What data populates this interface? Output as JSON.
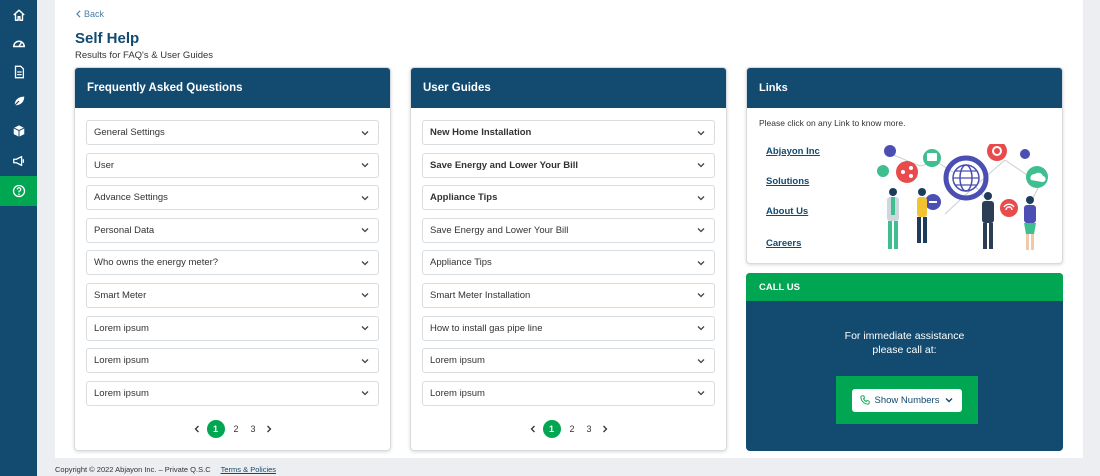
{
  "sidebar": {
    "items": [
      {
        "icon": "home-icon",
        "active": false
      },
      {
        "icon": "meter-icon",
        "active": false
      },
      {
        "icon": "document-icon",
        "active": false
      },
      {
        "icon": "leaf-icon",
        "active": false
      },
      {
        "icon": "box-icon",
        "active": false
      },
      {
        "icon": "megaphone-icon",
        "active": false
      },
      {
        "icon": "help-icon",
        "active": true
      }
    ]
  },
  "header": {
    "back_label": "Back",
    "title": "Self Help",
    "subtitle": "Results for FAQ's & User Guides"
  },
  "faq": {
    "title": "Frequently Asked Questions",
    "items": [
      "General Settings",
      "User",
      "Advance Settings",
      "Personal Data",
      "Who owns the energy meter?",
      "Smart Meter",
      "Lorem ipsum",
      "Lorem ipsum",
      "Lorem ipsum"
    ],
    "pages": [
      "1",
      "2",
      "3"
    ],
    "current_page": "1"
  },
  "guides": {
    "title": "User Guides",
    "items": [
      {
        "label": "New Home Installation",
        "bold": true
      },
      {
        "label": "Save Energy and Lower Your Bill",
        "bold": true
      },
      {
        "label": "Appliance Tips",
        "bold": true
      },
      {
        "label": "Save Energy and Lower Your Bill",
        "bold": false
      },
      {
        "label": "Appliance Tips",
        "bold": false
      },
      {
        "label": "Smart Meter Installation",
        "bold": false
      },
      {
        "label": "How to install gas pipe line",
        "bold": false
      },
      {
        "label": "Lorem ipsum",
        "bold": false
      },
      {
        "label": "Lorem ipsum",
        "bold": false
      }
    ],
    "pages": [
      "1",
      "2",
      "3"
    ],
    "current_page": "1"
  },
  "links": {
    "title": "Links",
    "intro": "Please click on any Link to know more.",
    "items": [
      "Abjayon Inc",
      "Solutions",
      "About Us",
      "Careers"
    ]
  },
  "call": {
    "title": "CALL US",
    "line1": "For immediate assistance",
    "line2": "please call at:",
    "button_label": "Show Numbers"
  },
  "footer": {
    "copyright": "Copyright © 2022 Abjayon Inc. – Private Q.S.C",
    "terms": "Terms & Policies"
  },
  "colors": {
    "navy": "#124a70",
    "green": "#00a651"
  }
}
